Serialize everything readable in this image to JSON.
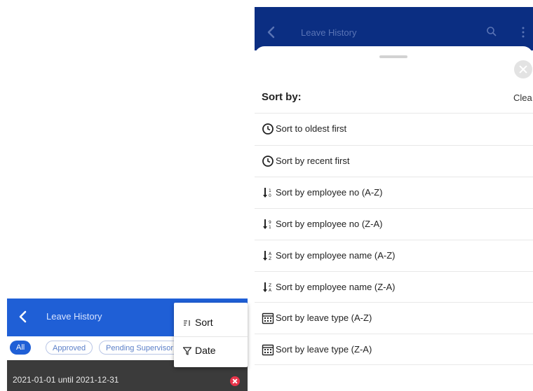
{
  "left_phone": {
    "header": {
      "title": "Leave History"
    },
    "filters": [
      {
        "label": "All",
        "active": true
      },
      {
        "label": "Approved",
        "active": false
      },
      {
        "label": "Pending Supervisor",
        "active": false
      }
    ],
    "date_range": {
      "text": "2021-01-01 until  2021-12-31"
    },
    "menu": {
      "items": [
        {
          "label": "Sort",
          "icon": "sort-icon"
        },
        {
          "label": "Date",
          "icon": "filter-icon"
        }
      ]
    }
  },
  "right_phone": {
    "header": {
      "title": "Leave History"
    },
    "sheet": {
      "title": "Sort by:",
      "clear_label": "Clea",
      "options": [
        {
          "label": "Sort to oldest first",
          "icon": "clock-icon"
        },
        {
          "label": "Sort by recent first",
          "icon": "clock-icon"
        },
        {
          "label": "Sort by employee no (A-Z)",
          "icon": "sort-numeric-asc-icon"
        },
        {
          "label": "Sort by employee no (Z-A)",
          "icon": "sort-numeric-desc-icon"
        },
        {
          "label": "Sort by employee name (A-Z)",
          "icon": "sort-alpha-asc-icon"
        },
        {
          "label": "Sort by employee name (Z-A)",
          "icon": "sort-alpha-desc-icon"
        },
        {
          "label": "Sort by leave type (A-Z)",
          "icon": "calendar-icon"
        },
        {
          "label": "Sort by leave type (Z-A)",
          "icon": "calendar-icon"
        }
      ]
    }
  },
  "colors": {
    "left_header": "#1f5fd6",
    "right_header": "#0b2e82",
    "date_row": "#3b3b3b",
    "clear_red": "#e8344a"
  }
}
